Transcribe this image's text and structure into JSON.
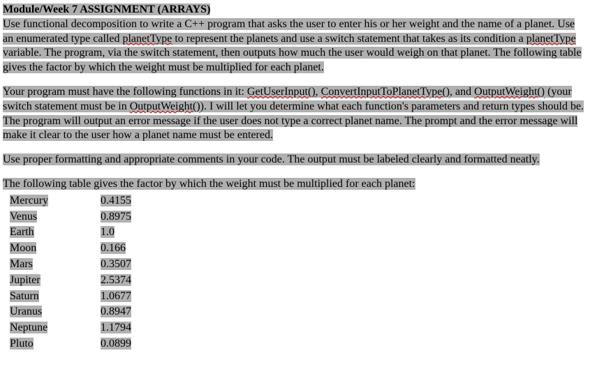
{
  "title_prefix": "Module/Week 7 A",
  "title_smallcaps": "SSIGNMENT",
  "title_suffix": " (A",
  "title_smallcaps2": "RRAYS",
  "title_end": ")",
  "para1_a": "Use functional decomposition to write a C++ program that asks the user to enter his or her weight and the name of a planet. Use an enumerated type called ",
  "para1_planetType1": "planetType",
  "para1_b": " to represent the planets and use a switch statement that takes as its condition a ",
  "para1_planetType2": "planetType",
  "para1_c": " variable. The program, via the switch statement, then outputs how much the user would weigh on that planet. The following table gives the factor by which the weight must be multiplied for each planet.",
  "para2_a": "Your program must have the following functions in it: ",
  "para2_fn1": "GetUserInput()",
  "para2_b": ", ",
  "para2_fn2": "ConvertInputToPlanetType()",
  "para2_c": ", and ",
  "para2_fn3": "OutputWeight()",
  "para2_d": " (your switch statement must be in ",
  "para2_fn4": "OutputWeight()",
  "para2_e": "). I will let you determine what each function's parameters and return types should be. The program will output an error message if the user does not type a correct planet name. The prompt and the error message will make it clear to the user how a planet name must be entered.",
  "para3": "Use proper formatting and appropriate comments in your code. The output must be labeled clearly and formatted neatly.",
  "table_intro": "The following table gives the factor by which the weight must be multiplied for each planet:",
  "rows": [
    {
      "name": "Mercury",
      "factor": "0.4155"
    },
    {
      "name": "Venus",
      "factor": "0.8975"
    },
    {
      "name": "Earth",
      "factor": "1.0"
    },
    {
      "name": "Moon",
      "factor": "0.166"
    },
    {
      "name": "Mars",
      "factor": "0.3507"
    },
    {
      "name": "Jupiter",
      "factor": "2.5374"
    },
    {
      "name": "Saturn",
      "factor": "1.0677"
    },
    {
      "name": "Uranus",
      "factor": "0.8947"
    },
    {
      "name": "Neptune",
      "factor": "1.1794"
    },
    {
      "name": "Pluto",
      "factor": "0.0899"
    }
  ]
}
